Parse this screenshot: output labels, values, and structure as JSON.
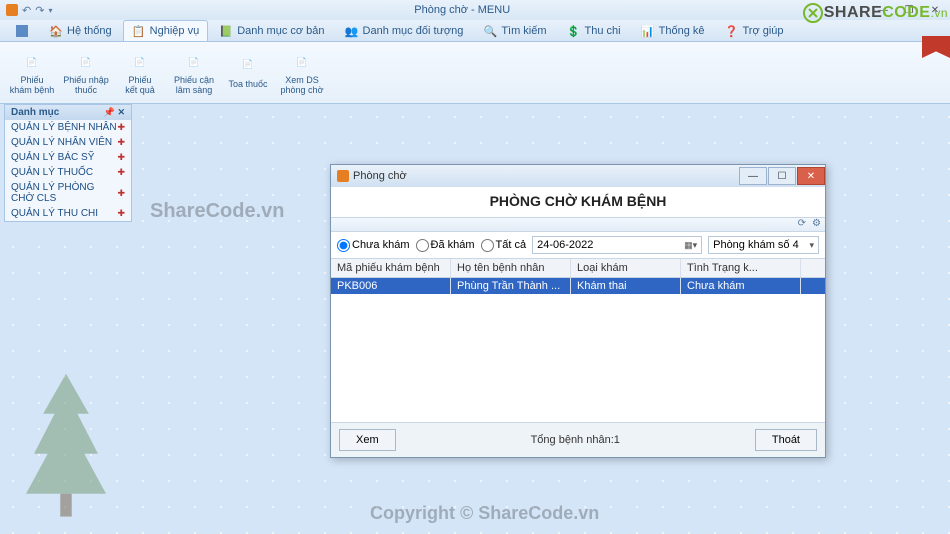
{
  "window": {
    "title": "Phòng chờ - MENU"
  },
  "tabs": [
    {
      "label": "Hệ thống"
    },
    {
      "label": "Nghiệp vụ"
    },
    {
      "label": "Danh mục cơ bản"
    },
    {
      "label": "Danh mục đối tượng"
    },
    {
      "label": "Tìm kiếm"
    },
    {
      "label": "Thu chi"
    },
    {
      "label": "Thống kê"
    },
    {
      "label": "Trợ giúp"
    }
  ],
  "ribbon_buttons": [
    {
      "l1": "Phiếu",
      "l2": "khám bệnh"
    },
    {
      "l1": "Phiếu nhập",
      "l2": "thuốc"
    },
    {
      "l1": "Phiếu",
      "l2": "kết quả"
    },
    {
      "l1": "Phiếu cận",
      "l2": "lâm sàng"
    },
    {
      "l1": "Toa thuốc",
      "l2": ""
    },
    {
      "l1": "Xem DS",
      "l2": "phòng chờ"
    }
  ],
  "sidebar": {
    "title": "Danh mục",
    "items": [
      "QUẢN LÝ BỆNH NHÂN",
      "QUẢN LÝ NHÂN VIÊN",
      "QUẢN LÝ BÁC SỸ",
      "QUẢN LÝ THUỐC",
      "QUẢN LÝ PHÒNG CHỜ CLS",
      "QUẢN LÝ THU CHI"
    ]
  },
  "dialog": {
    "title": "Phòng chờ",
    "heading": "PHÒNG CHỜ KHÁM BỆNH",
    "filters": {
      "r1": "Chưa khám",
      "r2": "Đã khám",
      "r3": "Tất cả",
      "date": "24-06-2022",
      "room": "Phòng khám số 4"
    },
    "columns": [
      "Mã phiếu khám bệnh",
      "Họ tên bệnh nhân",
      "Loại khám",
      "Tình Trạng k..."
    ],
    "rows": [
      {
        "c1": "PKB006",
        "c2": "Phùng Trần Thành ...",
        "c3": "Khám thai",
        "c4": "Chưa khám"
      }
    ],
    "footer": {
      "xem": "Xem",
      "total": "Tổng bệnh nhân:1",
      "thoat": "Thoát"
    }
  },
  "branding": {
    "share": "SHARE",
    "code": "CODE",
    "vn": ".vn"
  },
  "watermark1": "ShareCode.vn",
  "watermark2": "Copyright © ShareCode.vn"
}
